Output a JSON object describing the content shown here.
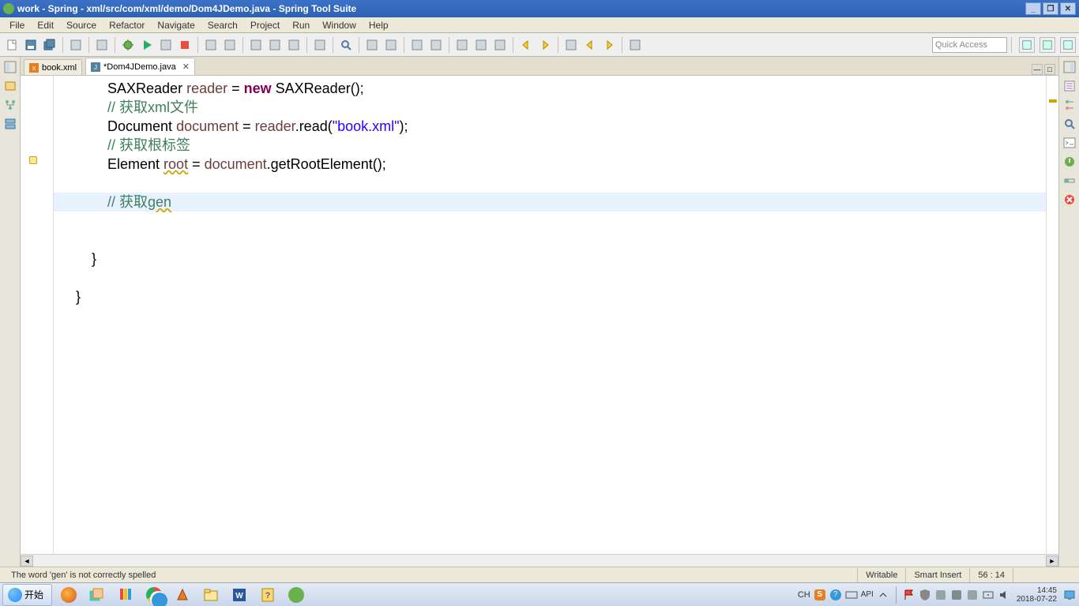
{
  "title": "work - Spring - xml/src/com/xml/demo/Dom4JDemo.java - Spring Tool Suite",
  "menu": [
    "File",
    "Edit",
    "Source",
    "Refactor",
    "Navigate",
    "Search",
    "Project",
    "Run",
    "Window",
    "Help"
  ],
  "quick_access_placeholder": "Quick Access",
  "tabs": [
    {
      "label": "book.xml",
      "active": false,
      "dirty": false,
      "icon": "xml"
    },
    {
      "label": "*Dom4JDemo.java",
      "active": true,
      "dirty": true,
      "icon": "java"
    }
  ],
  "code_lines": [
    {
      "indent": 3,
      "segs": [
        {
          "t": "SAXReader ",
          "c": ""
        },
        {
          "t": "reader",
          "c": "lv"
        },
        {
          "t": " = ",
          "c": ""
        },
        {
          "t": "new",
          "c": "kw"
        },
        {
          "t": " SAXReader();",
          "c": ""
        }
      ]
    },
    {
      "indent": 3,
      "segs": [
        {
          "t": "// 获取xml文件",
          "c": "cm"
        }
      ]
    },
    {
      "indent": 3,
      "segs": [
        {
          "t": "Document ",
          "c": ""
        },
        {
          "t": "document",
          "c": "lv"
        },
        {
          "t": " = ",
          "c": ""
        },
        {
          "t": "reader",
          "c": "lv"
        },
        {
          "t": ".read(",
          "c": ""
        },
        {
          "t": "\"book.xml\"",
          "c": "str"
        },
        {
          "t": ");",
          "c": ""
        }
      ]
    },
    {
      "indent": 3,
      "segs": [
        {
          "t": "// 获取根标签",
          "c": "cm"
        }
      ]
    },
    {
      "indent": 3,
      "segs": [
        {
          "t": "Element ",
          "c": ""
        },
        {
          "t": "root",
          "c": "lv warn"
        },
        {
          "t": " = ",
          "c": ""
        },
        {
          "t": "document",
          "c": "lv"
        },
        {
          "t": ".getRootElement();",
          "c": ""
        }
      ]
    },
    {
      "indent": 3,
      "segs": [
        {
          "t": "",
          "c": ""
        }
      ]
    },
    {
      "indent": 3,
      "segs": [
        {
          "t": "// 获取",
          "c": "cm"
        },
        {
          "t": "gen",
          "c": "cm warn"
        }
      ]
    },
    {
      "indent": 3,
      "segs": [
        {
          "t": "",
          "c": ""
        }
      ]
    },
    {
      "indent": 3,
      "segs": [
        {
          "t": "",
          "c": ""
        }
      ]
    },
    {
      "indent": 2,
      "segs": [
        {
          "t": "}",
          "c": ""
        }
      ]
    },
    {
      "indent": 0,
      "segs": [
        {
          "t": "",
          "c": ""
        }
      ]
    },
    {
      "indent": 1,
      "segs": [
        {
          "t": "}",
          "c": ""
        }
      ]
    }
  ],
  "highlight_line_index": 6,
  "status": {
    "msg": "The word 'gen' is not correctly spelled",
    "writable": "Writable",
    "insert": "Smart Insert",
    "pos": "56 : 14"
  },
  "taskbar": {
    "start": "开始",
    "ime": "CH",
    "api": "API",
    "time": "14:45",
    "date": "2018-07-22"
  }
}
